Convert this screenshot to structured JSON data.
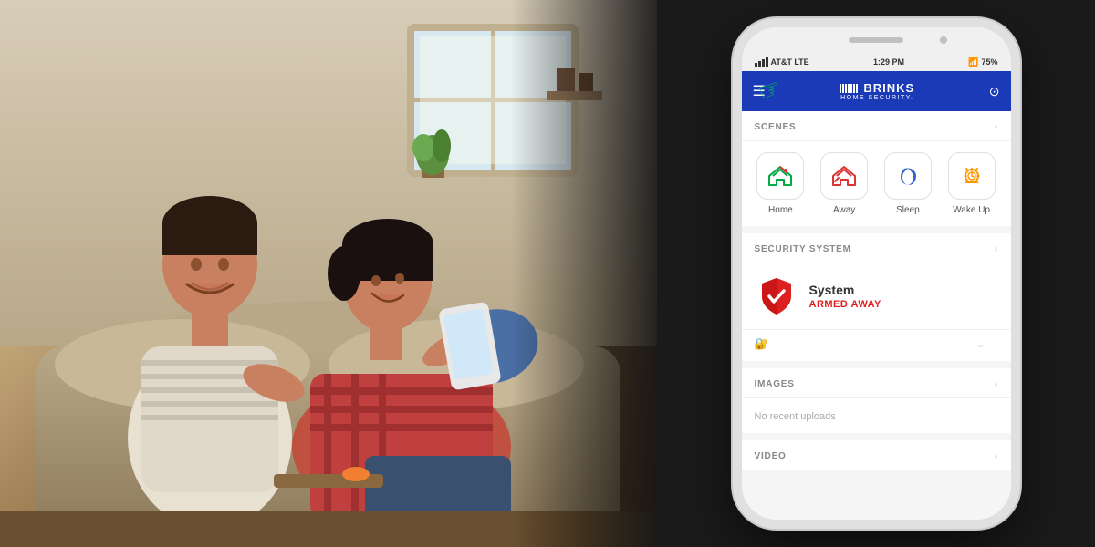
{
  "photo": {
    "alt": "Couple relaxing on couch with tablet"
  },
  "phone": {
    "status_bar": {
      "carrier": "AT&T  LTE",
      "time": "1:29 PM",
      "signal": "●●●",
      "wifi": "WiFi",
      "bluetooth": "BT",
      "battery": "75%"
    },
    "header": {
      "menu_icon": "☰",
      "logo_lines": "|||||||",
      "logo_name": "BRINKS",
      "logo_sub": "HOME SECURITY.",
      "settings_icon": "⊙"
    },
    "scenes": {
      "section_title": "SCENES",
      "items": [
        {
          "id": "home",
          "label": "Home",
          "icon": "🏠"
        },
        {
          "id": "away",
          "label": "Away",
          "icon": "🚪"
        },
        {
          "id": "sleep",
          "label": "Sleep",
          "icon": "🌙"
        },
        {
          "id": "wakeup",
          "label": "Wake Up",
          "icon": "⏰"
        }
      ]
    },
    "security": {
      "section_title": "SECURITY SYSTEM",
      "system_name": "System",
      "system_status": "ARMED AWAY",
      "lock_icon": "🔐"
    },
    "images": {
      "section_title": "IMAGES",
      "empty_message": "No recent uploads"
    },
    "video": {
      "section_title": "VIDEO"
    }
  },
  "colors": {
    "header_bg": "#1a3ab8",
    "status_armed": "#e02020",
    "section_bg": "#f5f5f5",
    "chevron": "#cccccc",
    "label_gray": "#888888"
  }
}
